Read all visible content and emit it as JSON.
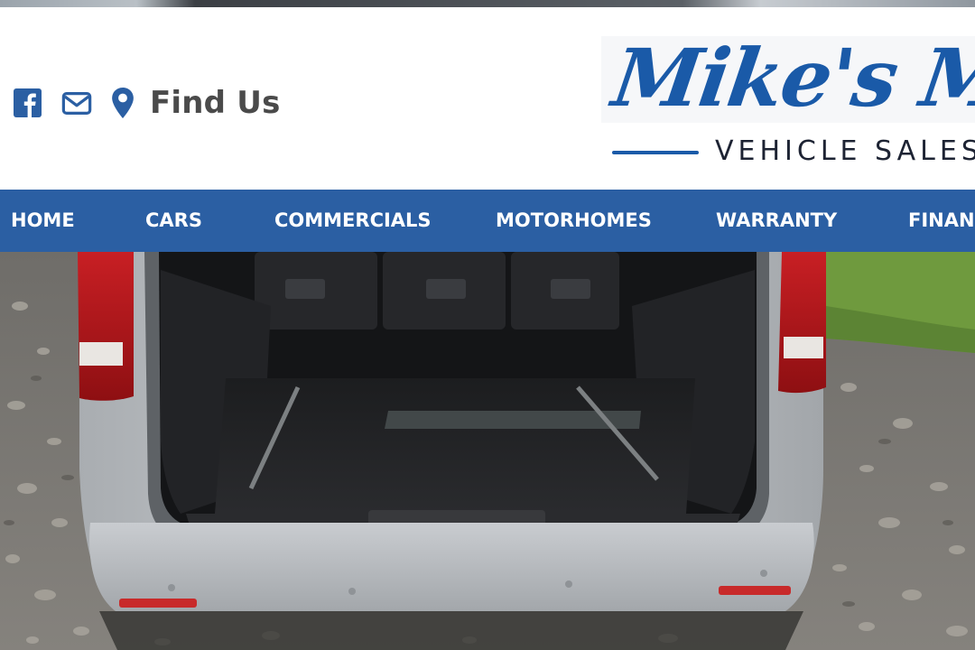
{
  "header": {
    "find_us_label": "Find Us",
    "icons": [
      "facebook-icon",
      "envelope-icon",
      "map-marker-icon"
    ]
  },
  "logo": {
    "title": "Mike's Motors",
    "subtitle": "VEHICLE SALES"
  },
  "nav": {
    "items": [
      {
        "label": "HOME"
      },
      {
        "label": "CARS"
      },
      {
        "label": "COMMERCIALS"
      },
      {
        "label": "MOTORHOMES"
      },
      {
        "label": "WARRANTY"
      },
      {
        "label": "FINANCE"
      }
    ]
  },
  "hero": {
    "subject": "van-rear-open-boot"
  },
  "colors": {
    "brand_blue": "#2b5fa3",
    "logo_blue": "#1a5aa8",
    "text_dark": "#4a4a4a"
  }
}
